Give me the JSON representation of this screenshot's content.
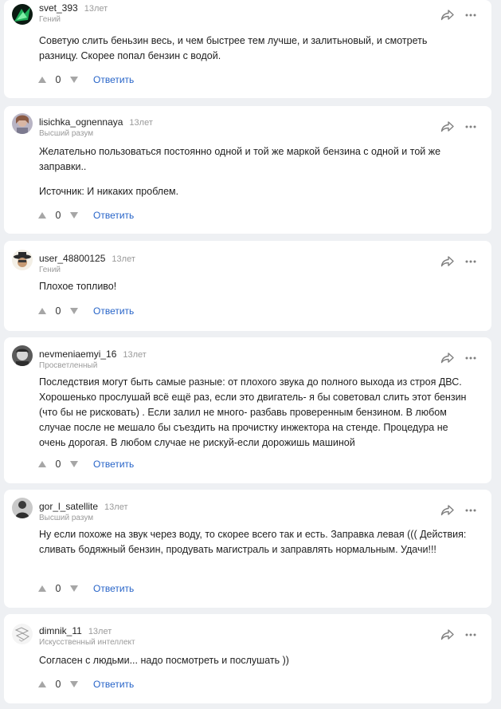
{
  "comments": [
    {
      "author": "svet_393",
      "time": "13лет",
      "rank": "Гений",
      "text": [
        "Советую слить беньзин весь, и чем быстрее тем лучше, и залитьновый, и смотреть разницу. Скорее попал бензин с водой."
      ],
      "score": "0",
      "reply_label": "Ответить",
      "avatar_icon": "abstract-green-avatar-icon"
    },
    {
      "author": "lisichka_ognennaya",
      "time": "13лет",
      "rank": "Высший разум",
      "text": [
        "Желательно пользоваться постоянно одной и той же маркой бензина с одной и той же заправки..",
        "Источник: И никаких проблем."
      ],
      "score": "0",
      "reply_label": "Ответить",
      "avatar_icon": "portrait-avatar-icon"
    },
    {
      "author": "user_48800125",
      "time": "13лет",
      "rank": "Гений",
      "text": [
        "Плохое топливо!"
      ],
      "score": "0",
      "reply_label": "Ответить",
      "avatar_icon": "hat-character-avatar-icon"
    },
    {
      "author": "nevmeniaemyi_16",
      "time": "13лет",
      "rank": "Просветленный",
      "text": [
        "Последствия могут быть самые разные: от плохого звука до полного выхода из строя ДВС. Хорошенько прослушай всё ещё раз, если это двигатель- я бы советовал слить этот бензин (что бы не рисковать) . Если залил не много- разбавь проверенным бензином. В любом случае после не мешало бы съездить на прочистку инжектора на стенде. Процедура не очень дорогая. В любом случае не рискуй-если дорожишь машиной"
      ],
      "score": "0",
      "reply_label": "Ответить",
      "avatar_icon": "bw-portrait-avatar-icon"
    },
    {
      "author": "gor_l_satellite",
      "time": "13лет",
      "rank": "Высший разум",
      "text": [
        "Ну если похоже на звук через воду, то скорее всего так и есть. Заправка левая ((( Действия: сливать бодяжный бензин, продувать магистраль и заправлять нормальным. Удачи!!!"
      ],
      "score": "0",
      "reply_label": "Ответить",
      "avatar_icon": "dark-figure-avatar-icon"
    },
    {
      "author": "dimnik_11",
      "time": "13лет",
      "rank": "Искусственный интеллект",
      "text": [
        "Согласен с людьми... надо посмотреть и послушать ))"
      ],
      "score": "0",
      "reply_label": "Ответить",
      "avatar_icon": "sketch-avatar-icon"
    }
  ],
  "colors": {
    "background": "#eef0f3",
    "card": "#ffffff",
    "reply_link": "#2764c8",
    "muted_text": "#9a9a9a"
  }
}
